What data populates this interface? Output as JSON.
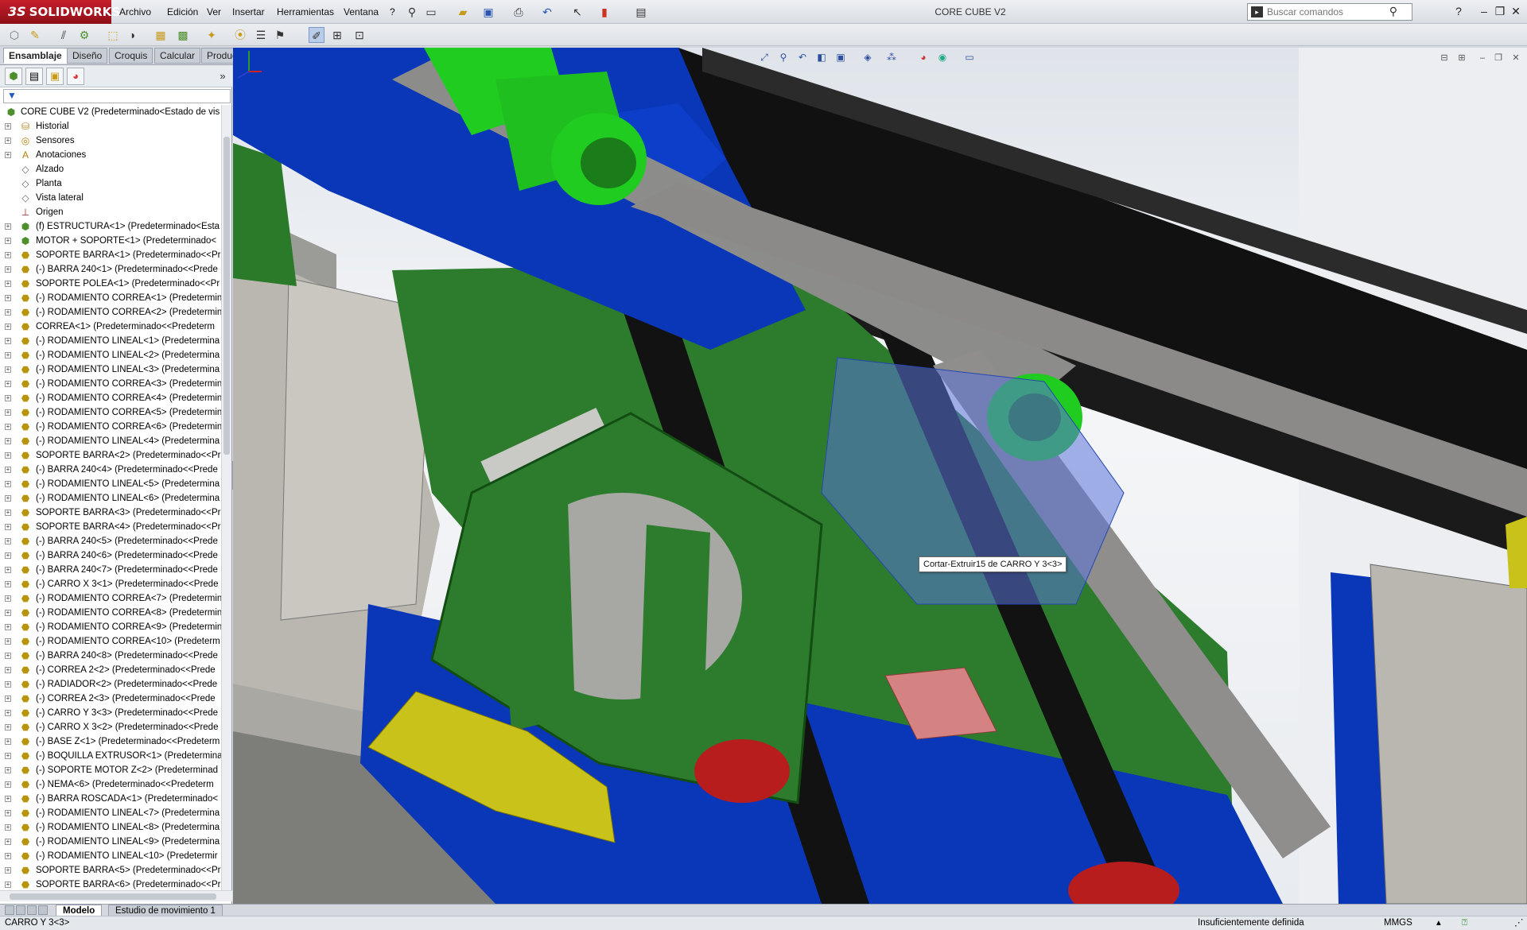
{
  "app": {
    "logo_ds": "3S",
    "logo_text": "SOLIDWORKS",
    "window_title": "CORE CUBE V2"
  },
  "menu": [
    "Archivo",
    "Edición",
    "Ver",
    "Insertar",
    "Herramientas",
    "Ventana",
    "?"
  ],
  "search": {
    "placeholder": "Buscar comandos"
  },
  "command_tabs": [
    "Ensamblaje",
    "Diseño",
    "Croquis",
    "Calcular",
    "Productos Office"
  ],
  "tree": {
    "root": "CORE CUBE V2  (Predeterminado<Estado de vis",
    "items": [
      {
        "label": "Historial",
        "icon": "folder-icon"
      },
      {
        "label": "Sensores",
        "icon": "sensor-icon"
      },
      {
        "label": "Anotaciones",
        "icon": "annotation-icon"
      },
      {
        "label": "Alzado",
        "icon": "plane-icon"
      },
      {
        "label": "Planta",
        "icon": "plane-icon"
      },
      {
        "label": "Vista lateral",
        "icon": "plane-icon"
      },
      {
        "label": "Origen",
        "icon": "origin-icon"
      },
      {
        "label": "(f) ESTRUCTURA<1> (Predeterminado<Esta",
        "icon": "assembly-icon"
      },
      {
        "label": "MOTOR + SOPORTE<1> (Predeterminado<",
        "icon": "assembly-icon"
      },
      {
        "label": "SOPORTE BARRA<1> (Predeterminado<<Pr",
        "icon": "part-icon"
      },
      {
        "label": "(-) BARRA 240<1> (Predeterminado<<Prede",
        "icon": "part-icon"
      },
      {
        "label": "SOPORTE POLEA<1> (Predeterminado<<Pr",
        "icon": "part-icon"
      },
      {
        "label": "(-) RODAMIENTO CORREA<1> (Predetermin",
        "icon": "part-icon"
      },
      {
        "label": "(-) RODAMIENTO CORREA<2> (Predetermin",
        "icon": "part-icon"
      },
      {
        "label": "CORREA<1> (Predeterminado<<Predeterm",
        "icon": "part-icon"
      },
      {
        "label": "(-) RODAMIENTO LINEAL<1> (Predetermina",
        "icon": "part-icon"
      },
      {
        "label": "(-) RODAMIENTO LINEAL<2> (Predetermina",
        "icon": "part-icon"
      },
      {
        "label": "(-) RODAMIENTO LINEAL<3> (Predetermina",
        "icon": "part-icon"
      },
      {
        "label": "(-) RODAMIENTO CORREA<3> (Predetermin",
        "icon": "part-icon"
      },
      {
        "label": "(-) RODAMIENTO CORREA<4> (Predetermin",
        "icon": "part-icon"
      },
      {
        "label": "(-) RODAMIENTO CORREA<5> (Predetermin",
        "icon": "part-icon"
      },
      {
        "label": "(-) RODAMIENTO CORREA<6> (Predetermin",
        "icon": "part-icon"
      },
      {
        "label": "(-) RODAMIENTO LINEAL<4> (Predetermina",
        "icon": "part-icon"
      },
      {
        "label": "SOPORTE BARRA<2> (Predeterminado<<Pr",
        "icon": "part-icon"
      },
      {
        "label": "(-) BARRA 240<4> (Predeterminado<<Prede",
        "icon": "part-icon"
      },
      {
        "label": "(-) RODAMIENTO LINEAL<5> (Predetermina",
        "icon": "part-icon"
      },
      {
        "label": "(-) RODAMIENTO LINEAL<6> (Predetermina",
        "icon": "part-icon"
      },
      {
        "label": "SOPORTE BARRA<3> (Predeterminado<<Pr",
        "icon": "part-icon"
      },
      {
        "label": "SOPORTE BARRA<4> (Predeterminado<<Pr",
        "icon": "part-icon"
      },
      {
        "label": "(-) BARRA 240<5> (Predeterminado<<Prede",
        "icon": "part-icon"
      },
      {
        "label": "(-) BARRA 240<6> (Predeterminado<<Prede",
        "icon": "part-icon"
      },
      {
        "label": "(-) BARRA 240<7> (Predeterminado<<Prede",
        "icon": "part-icon"
      },
      {
        "label": "(-) CARRO X 3<1> (Predeterminado<<Prede",
        "icon": "part-icon"
      },
      {
        "label": "(-) RODAMIENTO CORREA<7> (Predetermin",
        "icon": "part-icon"
      },
      {
        "label": "(-) RODAMIENTO CORREA<8> (Predetermin",
        "icon": "part-icon"
      },
      {
        "label": "(-) RODAMIENTO CORREA<9> (Predetermin",
        "icon": "part-icon"
      },
      {
        "label": "(-) RODAMIENTO CORREA<10> (Predeterm",
        "icon": "part-icon"
      },
      {
        "label": "(-) BARRA 240<8> (Predeterminado<<Prede",
        "icon": "part-icon"
      },
      {
        "label": "(-) CORREA 2<2> (Predeterminado<<Prede",
        "icon": "part-icon"
      },
      {
        "label": "(-) RADIADOR<2> (Predeterminado<<Prede",
        "icon": "part-icon"
      },
      {
        "label": "(-) CORREA 2<3> (Predeterminado<<Prede",
        "icon": "part-icon"
      },
      {
        "label": "(-) CARRO Y 3<3> (Predeterminado<<Prede",
        "icon": "part-icon"
      },
      {
        "label": "(-) CARRO X 3<2> (Predeterminado<<Prede",
        "icon": "part-icon"
      },
      {
        "label": "(-) BASE Z<1> (Predeterminado<<Predeterm",
        "icon": "part-icon"
      },
      {
        "label": "(-) BOQUILLA EXTRUSOR<1> (Predetermina",
        "icon": "part-icon"
      },
      {
        "label": "(-) SOPORTE MOTOR Z<2> (Predeterminad",
        "icon": "part-icon"
      },
      {
        "label": "(-) NEMA<6> (Predeterminado<<Predeterm",
        "icon": "part-icon"
      },
      {
        "label": "(-) BARRA ROSCADA<1> (Predeterminado<",
        "icon": "part-icon"
      },
      {
        "label": "(-) RODAMIENTO LINEAL<7> (Predetermina",
        "icon": "part-icon"
      },
      {
        "label": "(-) RODAMIENTO LINEAL<8> (Predetermina",
        "icon": "part-icon"
      },
      {
        "label": "(-) RODAMIENTO LINEAL<9> (Predetermina",
        "icon": "part-icon"
      },
      {
        "label": "(-) RODAMIENTO LINEAL<10> (Predetermir",
        "icon": "part-icon"
      },
      {
        "label": "SOPORTE BARRA<5> (Predeterminado<<Pr",
        "icon": "part-icon"
      },
      {
        "label": "SOPORTE BARRA<6> (Predeterminado<<Pr",
        "icon": "part-icon"
      }
    ]
  },
  "bottom_tabs": [
    "Modelo",
    "Estudio de movimiento 1"
  ],
  "status": {
    "selection": "CARRO Y 3<3>",
    "definition": "Insuficientemente definida",
    "units": "MMGS"
  },
  "viewport": {
    "tooltip": "Cortar-Extruir15 de CARRO Y 3<3>"
  },
  "colors": {
    "green_part": "#1f7a22",
    "bright_green": "#1fcc1f",
    "blue_part": "#0a36b8",
    "rod_grey": "#8c8c8a",
    "yellow_part": "#c8c21a",
    "red_part": "#b81d1d"
  }
}
